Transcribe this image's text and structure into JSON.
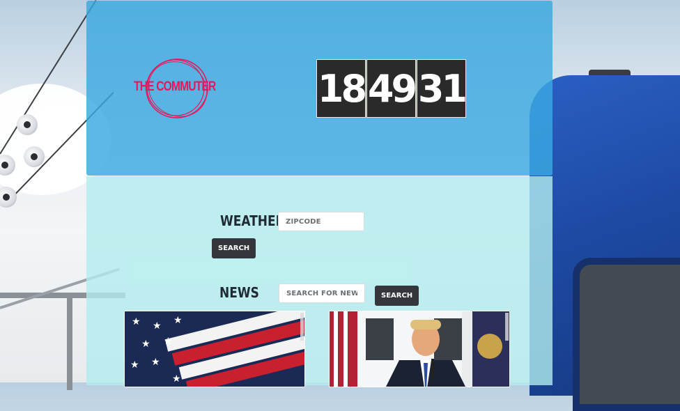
{
  "header": {
    "logo_text": "THE COMMUTER",
    "clock": {
      "hours": "18",
      "minutes": "49",
      "seconds": "31"
    }
  },
  "weather": {
    "label": "WEATHER",
    "zip_placeholder": "ZIPCODE",
    "search_label": "SEARCH"
  },
  "news": {
    "label": "NEWS",
    "search_placeholder": "SEARCH FOR NEWS",
    "search_label": "SEARCH"
  },
  "colors": {
    "header_bg": "#3aa8e0",
    "content_bg": "#b2ecee",
    "logo": "#e8175d",
    "button": "#33363a",
    "clock_bg": "#2a2a2a"
  }
}
